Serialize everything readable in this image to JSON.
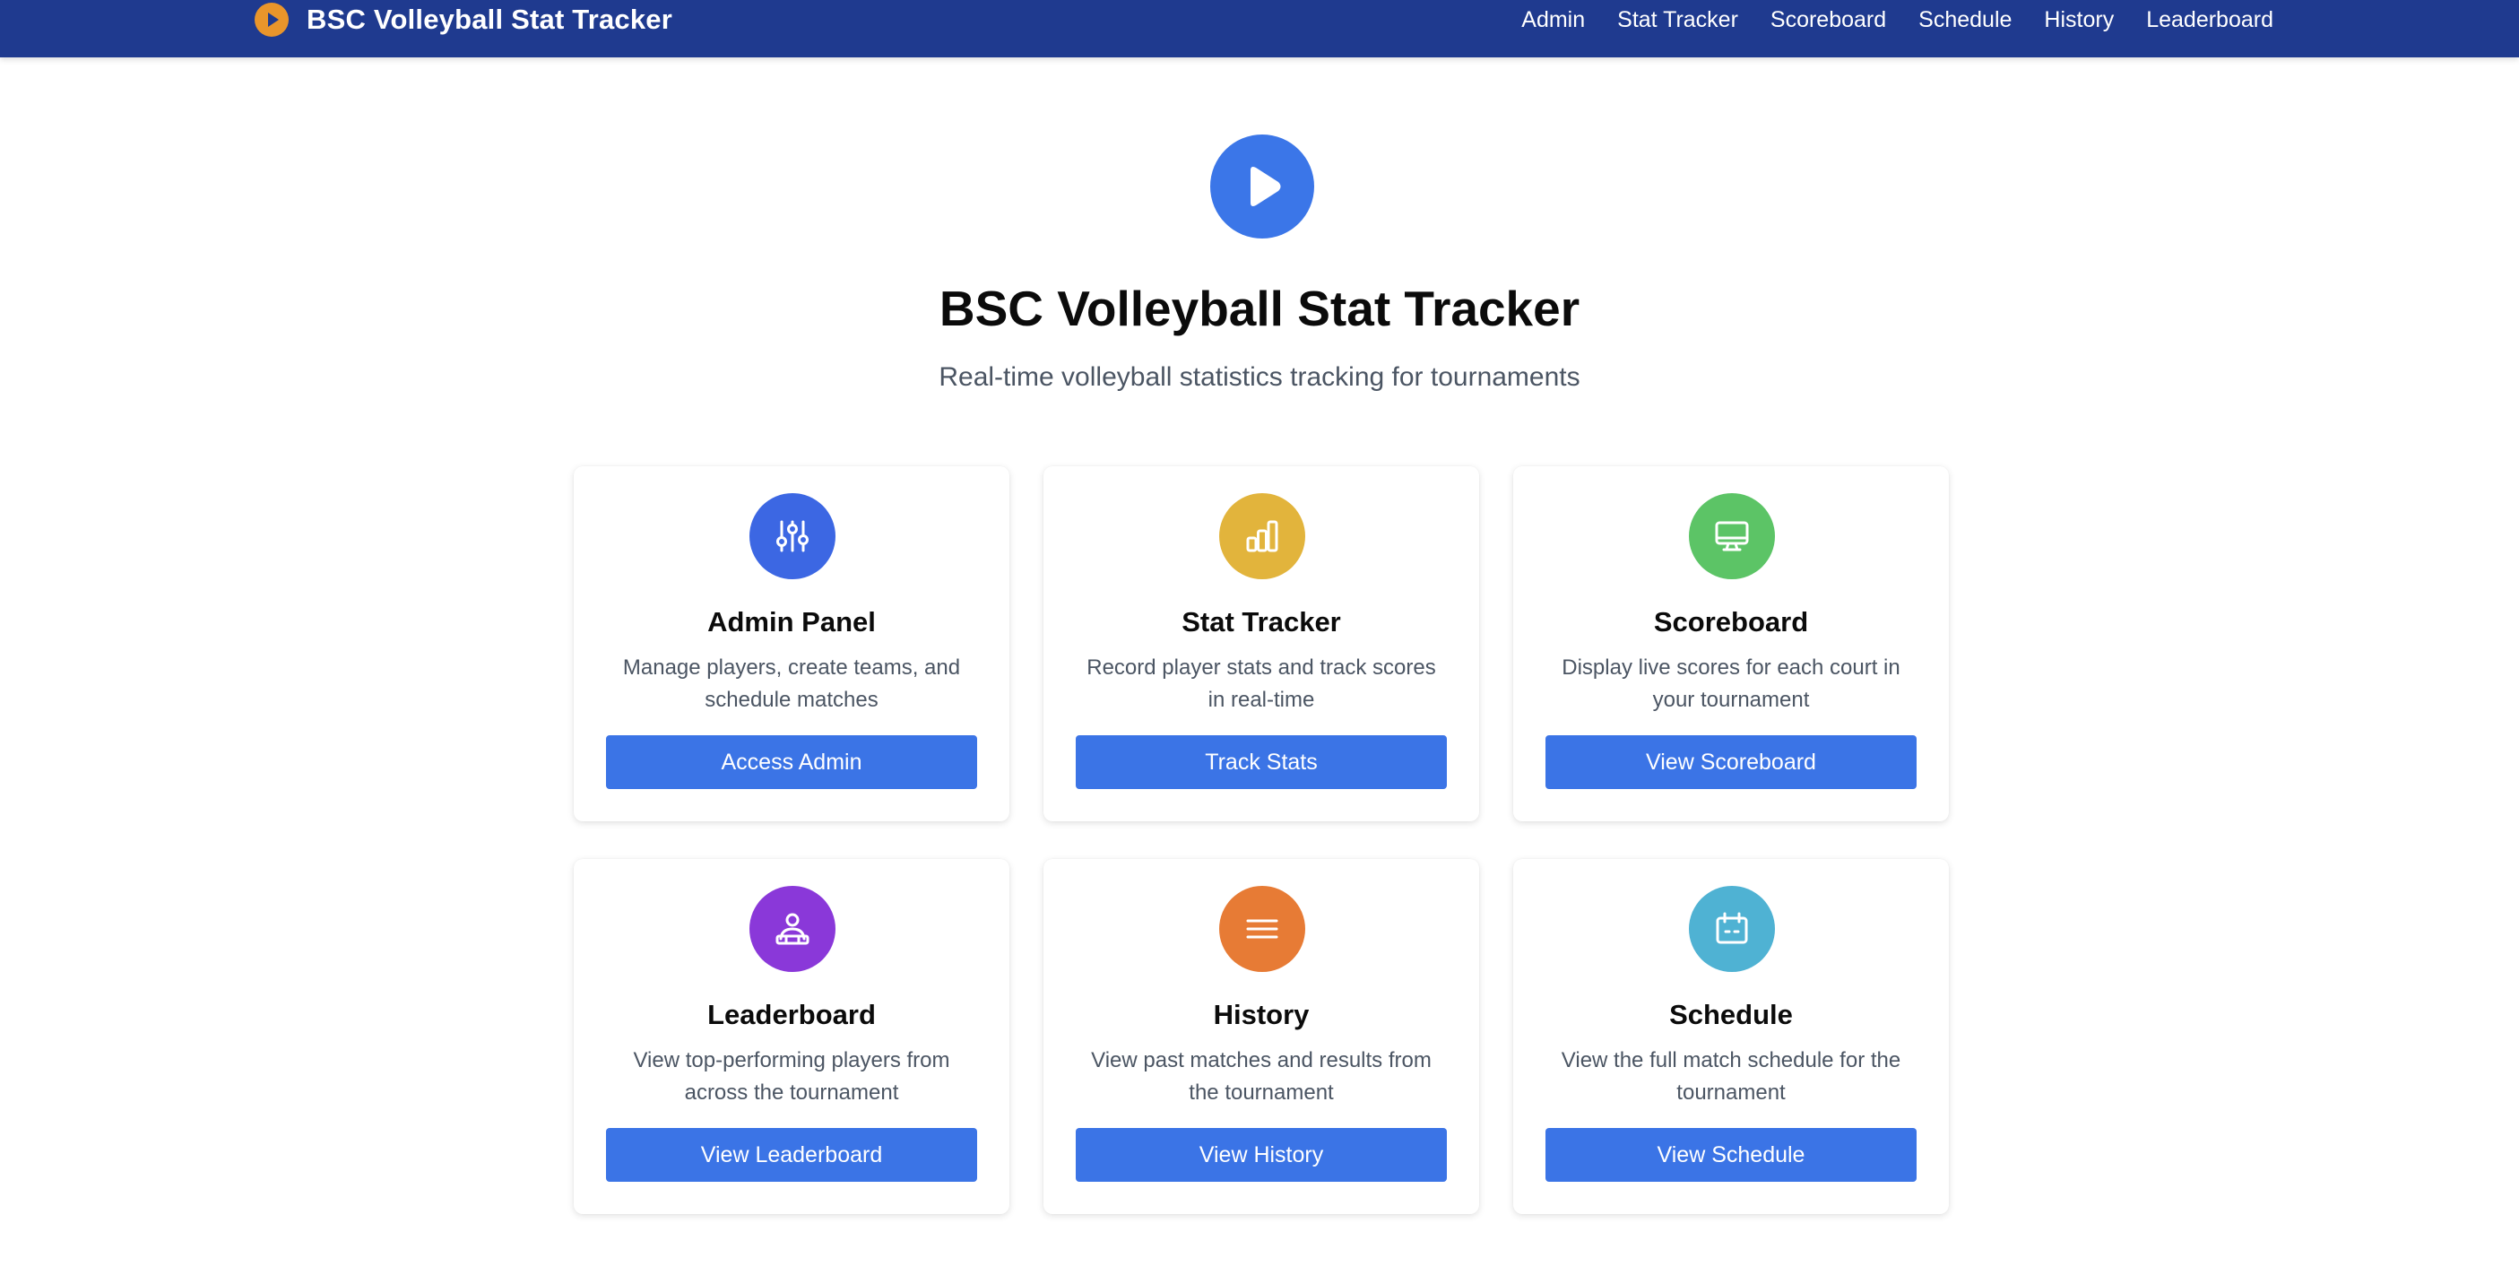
{
  "header": {
    "title": "BSC Volleyball Stat Tracker",
    "logo_icon": "play-circle-icon",
    "logo_color": "#e9952b",
    "background": "#1f3a8f",
    "nav": [
      "Admin",
      "Stat Tracker",
      "Scoreboard",
      "Schedule",
      "History",
      "Leaderboard"
    ]
  },
  "hero": {
    "icon": "play-icon",
    "icon_color": "#3b76e8",
    "title": "BSC Volleyball Stat Tracker",
    "subtitle": "Real-time volleyball statistics tracking for tournaments"
  },
  "cards": [
    {
      "title": "Admin Panel",
      "description": "Manage players, create teams, and schedule matches",
      "button": "Access Admin",
      "icon": "sliders-icon",
      "color": "#3c67e3"
    },
    {
      "title": "Stat Tracker",
      "description": "Record player stats and track scores in real-time",
      "button": "Track Stats",
      "icon": "bar-chart-icon",
      "color": "#e2b43c"
    },
    {
      "title": "Scoreboard",
      "description": "Display live scores for each court in your tournament",
      "button": "View Scoreboard",
      "icon": "monitor-icon",
      "color": "#5cc466"
    },
    {
      "title": "Leaderboard",
      "description": "View top-performing players from across the tournament",
      "button": "View Leaderboard",
      "icon": "user-podium-icon",
      "color": "#8a38d9"
    },
    {
      "title": "History",
      "description": "View past matches and results from the tournament",
      "button": "View History",
      "icon": "list-icon",
      "color": "#e77b35"
    },
    {
      "title": "Schedule",
      "description": "View the full match schedule for the tournament",
      "button": "View Schedule",
      "icon": "calendar-icon",
      "color": "#4fb2d3"
    }
  ],
  "button_color": "#3b74e6"
}
